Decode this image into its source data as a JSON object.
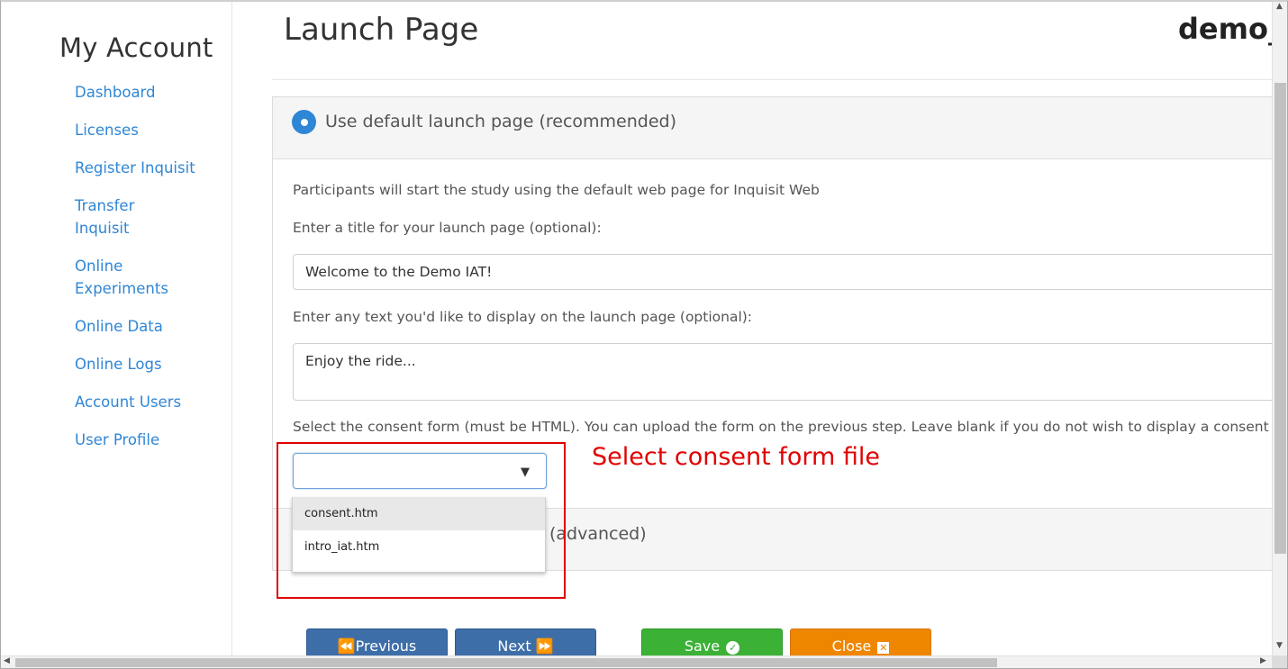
{
  "sidebar": {
    "title": "My Account",
    "items": [
      {
        "label": "Dashboard"
      },
      {
        "label": "Licenses"
      },
      {
        "label": "Register Inquisit"
      },
      {
        "label": "Transfer Inquisit"
      },
      {
        "label": "Online Experiments"
      },
      {
        "label": "Online Data"
      },
      {
        "label": "Online Logs"
      },
      {
        "label": "Account Users"
      },
      {
        "label": "User Profile"
      }
    ]
  },
  "header": {
    "title": "Launch Page",
    "user": "demo_"
  },
  "default_panel": {
    "radio_label": "Use default launch page (recommended)",
    "description": "Participants will start the study using the default web page for Inquisit Web",
    "title_label": "Enter a title for your launch page (optional):",
    "title_value": "Welcome to the Demo IAT!",
    "text_label": "Enter any text you'd like to display on the launch page (optional):",
    "text_value": "Enjoy the ride...",
    "consent_label": "Select the consent form (must be HTML). You can upload the form on the previous step. Leave blank if you do not wish to display a consent f",
    "consent_selected": ""
  },
  "advanced_panel": {
    "label": "(advanced)"
  },
  "consent_options": [
    {
      "label": "consent.htm"
    },
    {
      "label": "intro_iat.htm"
    }
  ],
  "annotation": {
    "text": "Select consent form file",
    "color": "#e00000"
  },
  "buttons": {
    "previous": "Previous",
    "next": "Next",
    "save": "Save",
    "close": "Close"
  },
  "colors": {
    "link": "#2f86d6",
    "nav_button": "#3d6ea8",
    "save_button": "#3bb135",
    "close_button": "#ef8600"
  }
}
